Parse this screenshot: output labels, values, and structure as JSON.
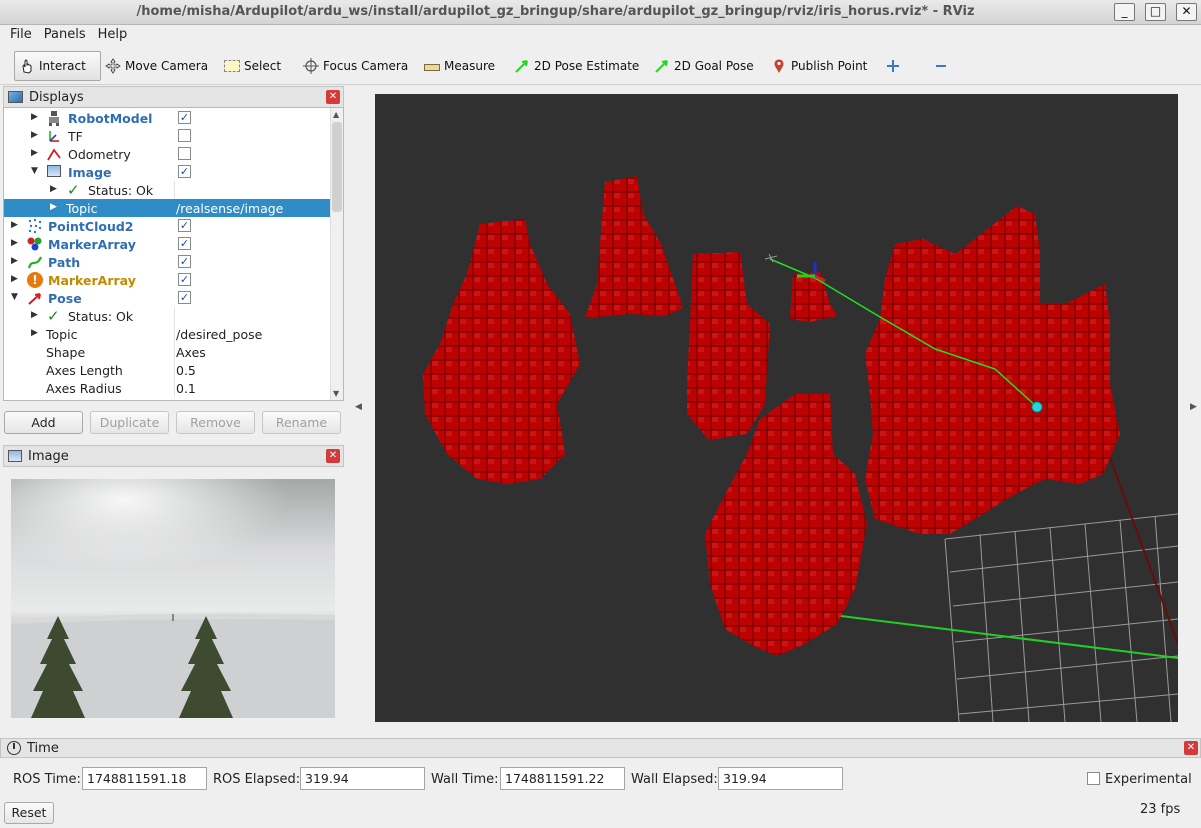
{
  "window": {
    "title": "/home/misha/Ardupilot/ardu_ws/install/ardupilot_gz_bringup/share/ardupilot_gz_bringup/rviz/iris_horus.rviz* - RViz",
    "controls": [
      "_",
      "□",
      "✕"
    ]
  },
  "menu": [
    "File",
    "Panels",
    "Help"
  ],
  "toolbar": {
    "interact": "Interact",
    "move_camera": "Move Camera",
    "select": "Select",
    "focus_camera": "Focus Camera",
    "measure": "Measure",
    "pose_estimate": "2D Pose Estimate",
    "goal_pose": "2D Goal Pose",
    "publish_point": "Publish Point"
  },
  "displays": {
    "title": "Displays",
    "rows": [
      {
        "label": "RobotModel",
        "style": "blue",
        "checked": true
      },
      {
        "label": "TF",
        "checked": false
      },
      {
        "label": "Odometry",
        "checked": false
      },
      {
        "label": "Image",
        "style": "blue",
        "checked": true
      },
      {
        "label": "Status: Ok"
      },
      {
        "label": "Topic",
        "value": "/realsense/image",
        "selected": true
      },
      {
        "label": "PointCloud2",
        "style": "blue",
        "checked": true
      },
      {
        "label": "MarkerArray",
        "style": "blue",
        "checked": true
      },
      {
        "label": "Path",
        "style": "blue",
        "checked": true
      },
      {
        "label": "MarkerArray",
        "style": "orange",
        "checked": true
      },
      {
        "label": "Pose",
        "style": "blue",
        "checked": true
      },
      {
        "label": "Status: Ok"
      },
      {
        "label": "Topic",
        "value": "/desired_pose"
      },
      {
        "label": "Shape",
        "value": "Axes"
      },
      {
        "label": "Axes Length",
        "value": "0.5"
      },
      {
        "label": "Axes Radius",
        "value": "0.1"
      }
    ],
    "buttons": {
      "add": "Add",
      "duplicate": "Duplicate",
      "remove": "Remove",
      "rename": "Rename"
    }
  },
  "image_panel": {
    "title": "Image"
  },
  "time_panel": {
    "title": "Time",
    "ros_time_label": "ROS Time:",
    "ros_time": "1748811591.18",
    "ros_elapsed_label": "ROS Elapsed:",
    "ros_elapsed": "319.94",
    "wall_time_label": "Wall Time:",
    "wall_time": "1748811591.22",
    "wall_elapsed_label": "Wall Elapsed:",
    "wall_elapsed": "319.94",
    "experimental": "Experimental",
    "reset": "Reset",
    "fps": "23 fps"
  },
  "colors": {
    "accent": "#308cc6",
    "voxel": "#d40000",
    "viewport_bg": "#303030",
    "path": "#22e022"
  }
}
